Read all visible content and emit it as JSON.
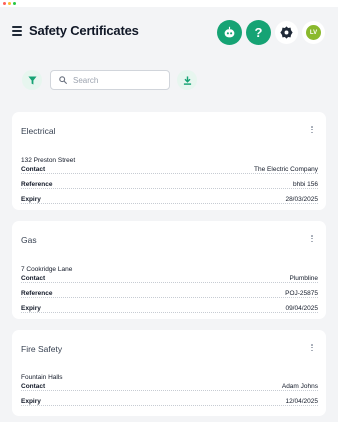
{
  "header": {
    "title": "Safety Certificates",
    "help_label": "?",
    "avatar_initials": "LV"
  },
  "toolbar": {
    "search_placeholder": "Search"
  },
  "colors": {
    "accent": "#16a374",
    "accent_light": "#e7f6ef",
    "avatar": "#8ab92d"
  },
  "icons": [
    "menu-icon",
    "robot-icon",
    "help-icon",
    "gear-icon",
    "filter-icon",
    "search-icon",
    "download-icon",
    "more-vertical-icon"
  ],
  "certificates": [
    {
      "type": "Electrical",
      "address": "132 Preston Street",
      "fields": [
        {
          "label": "Contact",
          "value": "The Electric Company"
        },
        {
          "label": "Reference",
          "value": "bhbi 156"
        },
        {
          "label": "Expiry",
          "value": "28/03/2025"
        }
      ]
    },
    {
      "type": "Gas",
      "address": "7 Cookridge Lane",
      "fields": [
        {
          "label": "Contact",
          "value": "Plumbline"
        },
        {
          "label": "Reference",
          "value": "POJ-25875"
        },
        {
          "label": "Expiry",
          "value": "09/04/2025"
        }
      ]
    },
    {
      "type": "Fire Safety",
      "address": "Fountain Halls",
      "fields": [
        {
          "label": "Contact",
          "value": "Adam Johns"
        },
        {
          "label": "Expiry",
          "value": "12/04/2025"
        }
      ]
    }
  ]
}
